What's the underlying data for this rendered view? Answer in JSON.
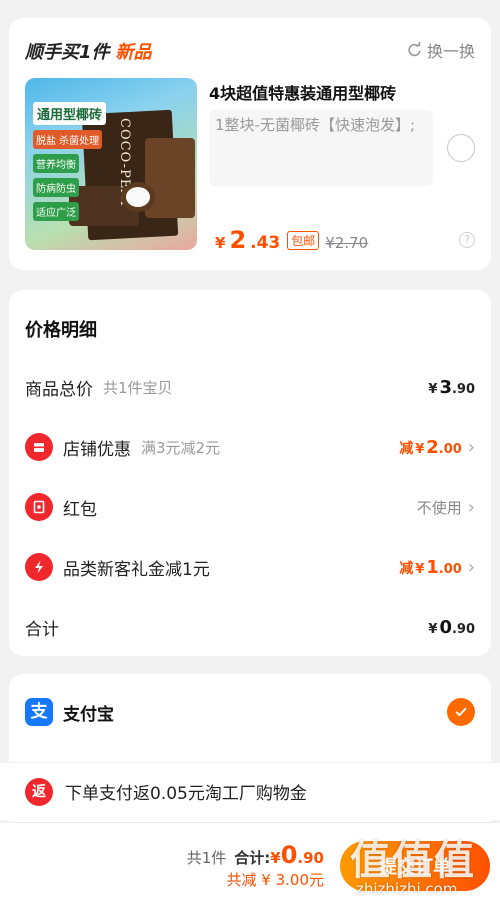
{
  "top_card": {
    "title": "顺手买1件",
    "title_badge": "新品",
    "swap_label": "换一换",
    "product": {
      "image_label": "通用型椰砖",
      "image_tags": [
        "脱盐 杀菌处理",
        "营养均衡",
        "防病防虫",
        "适应广泛"
      ],
      "image_package_text": "COCO-PEAT",
      "title": "4块超值特惠装通用型椰砖",
      "spec": "1整块-无菌椰砖【快速泡发】;",
      "price_yen": "¥",
      "price_int": "2",
      "price_dec": ".43",
      "shipping_badge": "包邮",
      "original_price": "¥2.70"
    },
    "help_icon_text": "?"
  },
  "price_detail": {
    "title": "价格明细",
    "rows": [
      {
        "label": "商品总价",
        "sub": "共1件宝贝",
        "yen": "¥",
        "int": "3",
        "cents": ".90"
      },
      {
        "label": "店铺优惠",
        "sub": "满3元减2元",
        "reduce": "减",
        "yen": "¥",
        "int": "2",
        "cents": ".00"
      },
      {
        "label": "红包",
        "value": "不使用"
      },
      {
        "label": "品类新客礼金减1元",
        "reduce": "减",
        "yen": "¥",
        "int": "1",
        "cents": ".00"
      },
      {
        "label": "合计",
        "yen": "¥",
        "int": "0",
        "cents": ".90"
      }
    ]
  },
  "payment": {
    "logo_text": "支",
    "name": "支付宝"
  },
  "promo": {
    "icon_text": "返",
    "text": "下单支付返0.05元淘工厂购物金"
  },
  "bottom_bar": {
    "count": "共1件",
    "total_label": "合计:",
    "total_yen": "¥",
    "total_int": "0",
    "total_cents": ".90",
    "saving": "共减 ¥ 3.00元",
    "submit_label": "提交订单"
  },
  "watermark": {
    "text": "值值值",
    "url": "zhizhizhi.com"
  },
  "colors": {
    "accent": "#ff5000",
    "alipay": "#1677ff",
    "red_icon": "#f0282e"
  }
}
